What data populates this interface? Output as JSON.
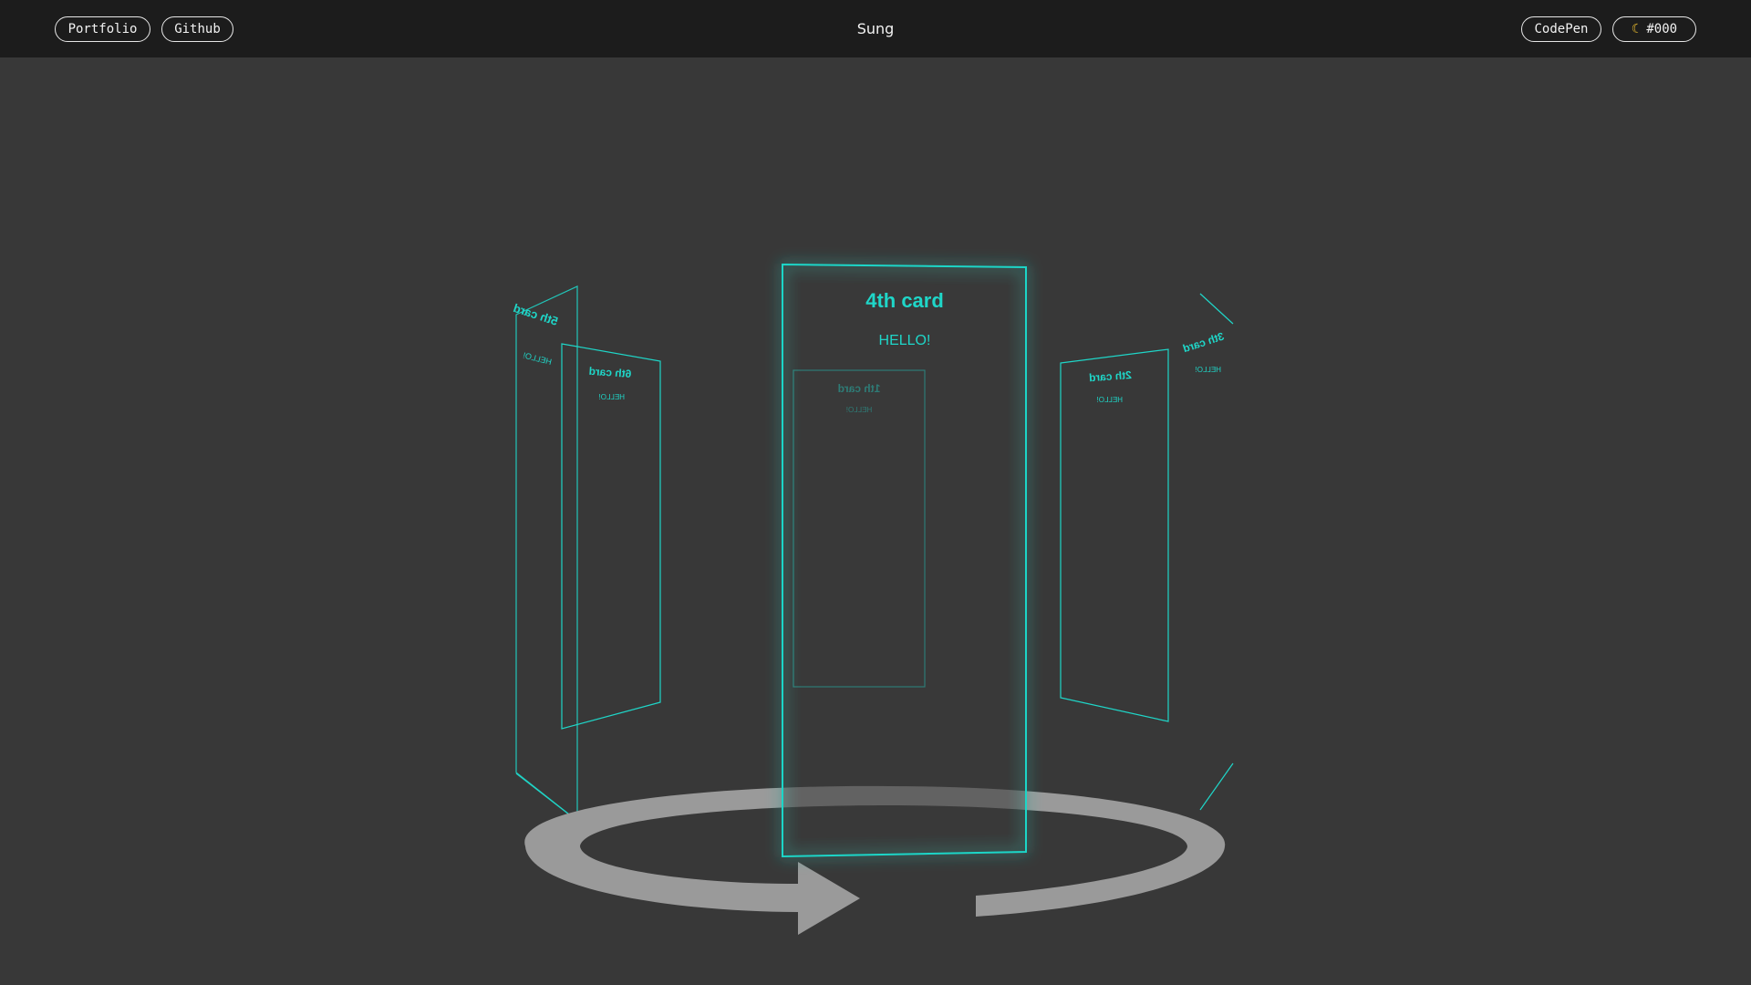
{
  "header": {
    "title": "Sung",
    "left_links": [
      "Portfolio",
      "Github"
    ],
    "right_links": {
      "codepen": "CodePen",
      "theme_label": "#000"
    }
  },
  "carousel": {
    "front_card": {
      "title": "4th card",
      "text": "HELLO!"
    },
    "inner_card": {
      "title": "1th card",
      "text": "HELLO!"
    },
    "left_card": {
      "title": "6th card",
      "text": "HELLO!"
    },
    "far_left_card": {
      "title": "5th card",
      "text": "HELLO!"
    },
    "right_card": {
      "title": "2th card",
      "text": "HELLO!"
    },
    "far_right_card": {
      "title": "3th card",
      "text": "HELLO!"
    }
  },
  "colors": {
    "accent": "#1fd6c8",
    "background": "#383838",
    "topbar": "#1c1c1c",
    "arrow": "#9a9a9a"
  },
  "icons": {
    "theme_icon": "moon-icon",
    "rotate_icon": "rotate-arrow-icon"
  }
}
